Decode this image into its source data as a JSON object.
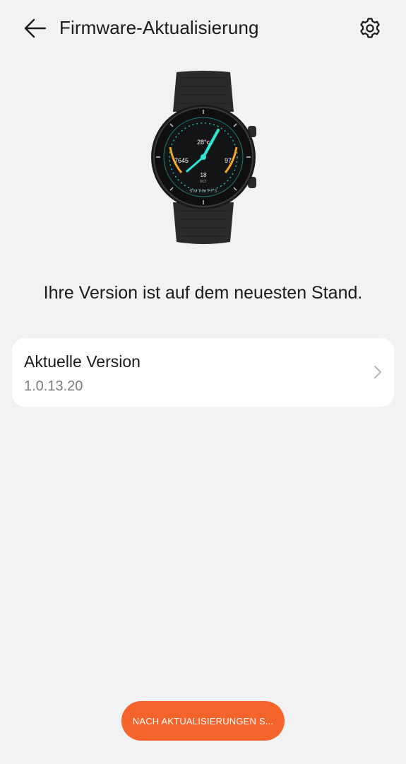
{
  "header": {
    "title": "Firmware-Aktualisierung",
    "back_icon": "arrow-left-icon",
    "settings_icon": "gear-icon"
  },
  "watch_face": {
    "temperature": "28°c",
    "steps": "7645",
    "heart_rate": "97",
    "date_day": "18",
    "date_month": "OCT",
    "weekdays": "S M T W T F S",
    "accent_color": "#2ee6d6",
    "secondary_color": "#f5a623"
  },
  "status": {
    "text": "Ihre Version ist auf dem neuesten Stand."
  },
  "version_card": {
    "label": "Aktuelle Version",
    "value": "1.0.13.20",
    "chevron_icon": "chevron-right-icon"
  },
  "actions": {
    "check_label": "NACH AKTUALISIERUNGEN S...",
    "accent": "#f5642b"
  }
}
